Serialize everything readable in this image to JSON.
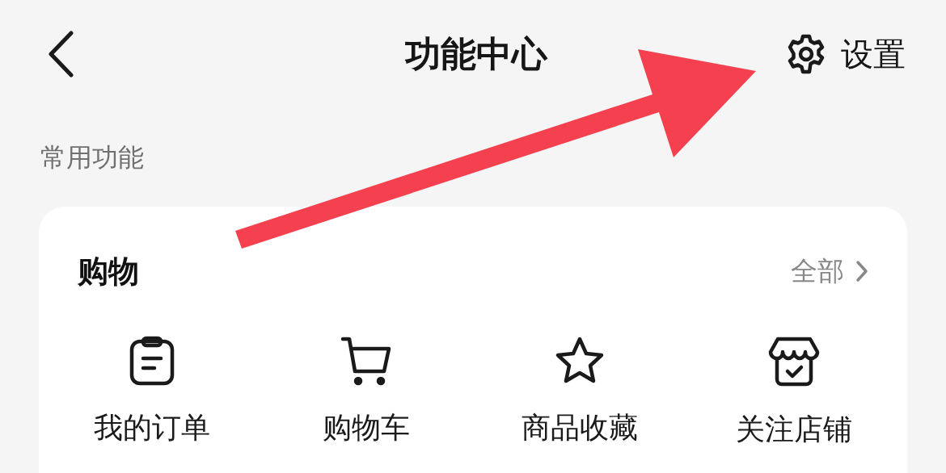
{
  "header": {
    "title": "功能中心",
    "settings_label": "设置"
  },
  "section_label": "常用功能",
  "card": {
    "title": "购物",
    "more_label": "全部",
    "items": [
      {
        "label": "我的订单"
      },
      {
        "label": "购物车"
      },
      {
        "label": "商品收藏"
      },
      {
        "label": "关注店铺"
      }
    ]
  }
}
